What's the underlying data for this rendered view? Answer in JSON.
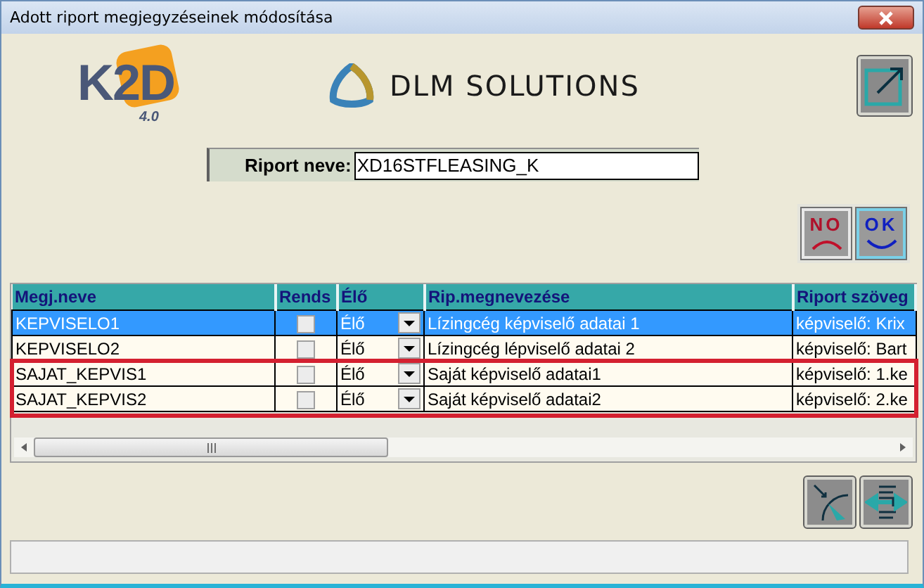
{
  "window": {
    "title": "Adott riport megjegyzéseinek módosítása"
  },
  "logos": {
    "product": "K2D",
    "version": "4.0",
    "company": "DLM SOLUTIONS"
  },
  "report_name": {
    "label": "Riport neve:",
    "value": "XD16STFLEASING_K"
  },
  "actions": [
    {
      "kind": "no",
      "label": "NO"
    },
    {
      "kind": "ok",
      "label": "OK"
    }
  ],
  "table": {
    "columns": [
      "Megj.neve",
      "Rends",
      "Élő",
      "Rip.megnevezése",
      "Riport szöveg"
    ],
    "rows": [
      {
        "name": "KEPVISELO1",
        "checked": false,
        "status": "Élő",
        "description": "Lízingcég képviselő adatai 1",
        "text": "képviselő: Krix",
        "selected": true,
        "marked": false
      },
      {
        "name": "KEPVISELO2",
        "checked": false,
        "status": "Élő",
        "description": "Lízingcég lépviselő adatai 2",
        "text": "képviselő: Bart",
        "selected": false,
        "marked": false
      },
      {
        "name": "SAJAT_KEPVIS1",
        "checked": false,
        "status": "Élő",
        "description": "Saját képviselő adatai1",
        "text": "képviselő: 1.ke",
        "selected": false,
        "marked": true
      },
      {
        "name": "SAJAT_KEPVIS2",
        "checked": false,
        "status": "Élő",
        "description": "Saját képviselő adatai2",
        "text": "képviselő: 2.ke",
        "selected": false,
        "marked": true
      }
    ]
  }
}
